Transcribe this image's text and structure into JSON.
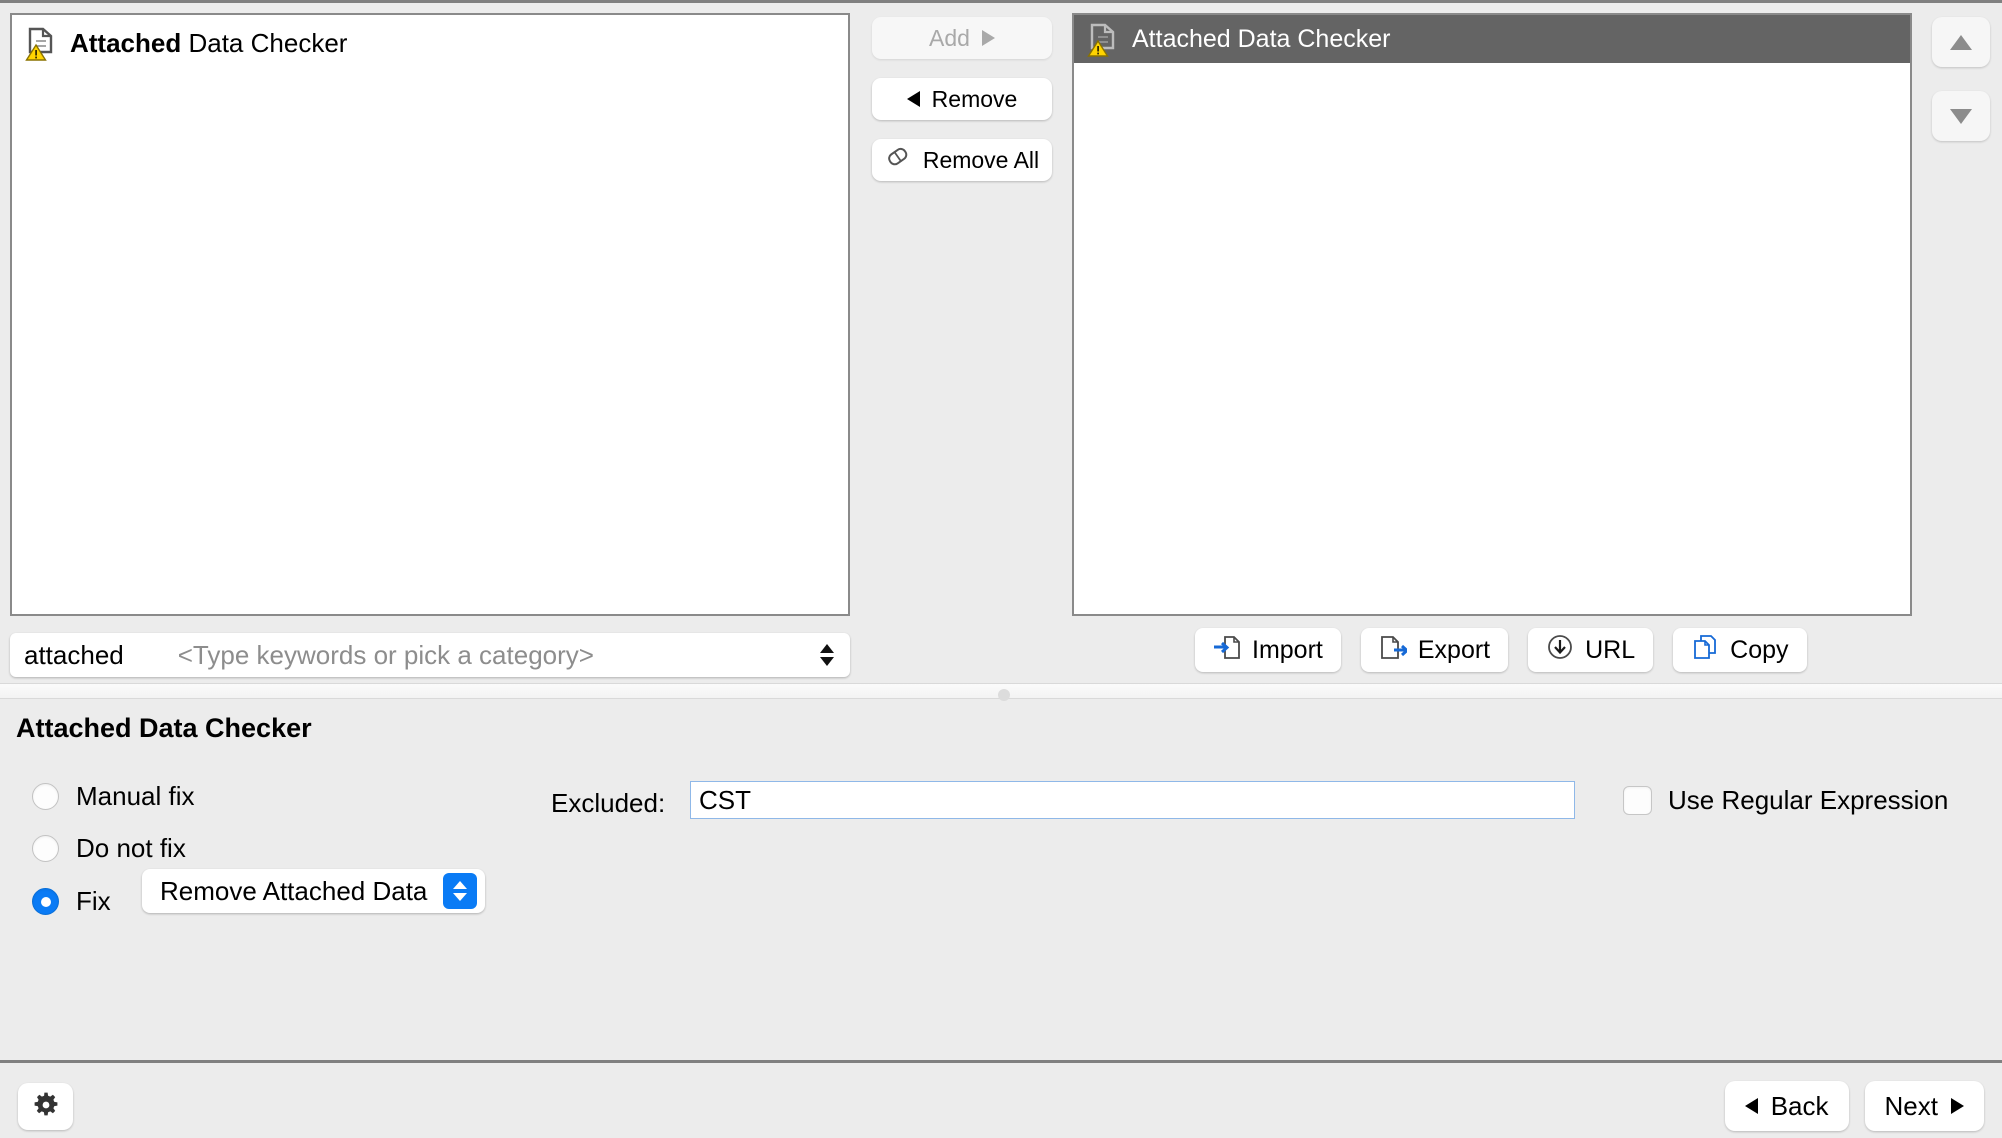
{
  "left_list": {
    "items": [
      {
        "bold_part": "Attached",
        "rest": " Data Checker",
        "icon": "document-warning-icon"
      }
    ]
  },
  "transfer_buttons": [
    {
      "label": "Add",
      "icon": "triangle-right-icon",
      "disabled": true
    },
    {
      "label": "Remove",
      "icon": "triangle-left-icon",
      "disabled": false
    },
    {
      "label": "Remove All",
      "icon": "eraser-icon",
      "disabled": false
    }
  ],
  "right_list": {
    "items": [
      {
        "label": "Attached Data Checker",
        "icon": "document-warning-icon",
        "selected": true
      }
    ]
  },
  "reorder_buttons": [
    {
      "name": "move-up-button",
      "icon": "triangle-up-icon"
    },
    {
      "name": "move-down-button",
      "icon": "triangle-down-icon"
    }
  ],
  "keyword_combo": {
    "value": "attached",
    "placeholder": "<Type keywords or pick a category>"
  },
  "io_buttons": [
    {
      "label": "Import",
      "icon": "import-document-icon"
    },
    {
      "label": "Export",
      "icon": "export-document-icon"
    },
    {
      "label": "URL",
      "icon": "download-circle-icon"
    },
    {
      "label": "Copy",
      "icon": "copy-documents-icon"
    }
  ],
  "settings": {
    "title": "Attached Data Checker",
    "radios": [
      {
        "label": "Manual fix",
        "selected": false
      },
      {
        "label": "Do not fix",
        "selected": false
      },
      {
        "label": "Fix",
        "selected": true
      }
    ],
    "fix_action": {
      "selected": "Remove Attached Data"
    },
    "excluded": {
      "label": "Excluded:",
      "value": "CST"
    },
    "regex": {
      "label": "Use Regular Expression",
      "checked": false
    }
  },
  "footer": {
    "settings_icon": "gear-icon",
    "back_label": "Back",
    "next_label": "Next"
  },
  "colors": {
    "accent_blue": "#0a7bf5",
    "selection_gray": "#646464",
    "window_bg": "#ececec",
    "warning_yellow": "#ffd400",
    "field_border_blue": "#8fb8e8"
  }
}
